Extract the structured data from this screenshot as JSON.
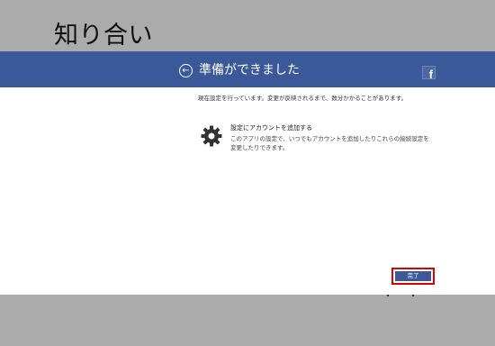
{
  "app": {
    "title": "知り合い"
  },
  "dialog": {
    "title": "準備ができました",
    "back_icon": "back-arrow-icon",
    "back_glyph": "←",
    "brand_icon": "facebook-logo-icon",
    "brand_glyph": "f",
    "status": "現在設定を行っています。変更が反映されるまで、数分かかることがあります。",
    "account": {
      "icon": "gear-icon",
      "title": "設定にアカウントを追加する",
      "description": "このアプリの設定で、いつでもアカウントを追加したりこれらの接続設定を変更したりできます。"
    },
    "done_label": "完了"
  },
  "colors": {
    "header": "#3b5998",
    "background": "#ababab",
    "highlight": "#e00000"
  }
}
